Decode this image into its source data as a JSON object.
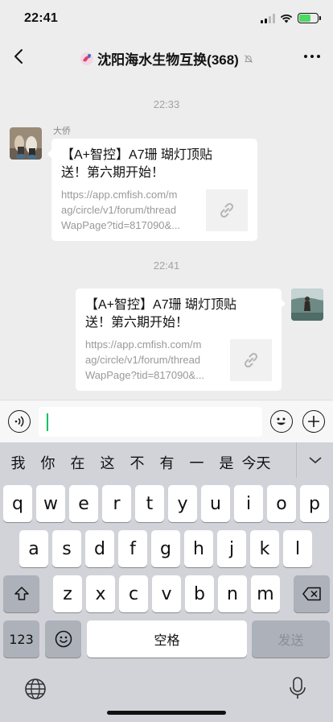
{
  "status_bar": {
    "time": "22:41"
  },
  "nav": {
    "title": "沈阳海水生物互换(368)"
  },
  "messages": [
    {
      "timestamp": "22:33"
    },
    {
      "sender": "大侨",
      "title": "【A+智控】A7珊 瑚灯顶贴\n送！第六期开始！",
      "desc": "https://app.cmfish.com/m\nag/circle/v1/forum/thread\nWapPage?tid=817090&..."
    },
    {
      "timestamp": "22:41"
    },
    {
      "title": "【A+智控】A7珊 瑚灯顶贴\n送！第六期开始！",
      "desc": "https://app.cmfish.com/m\nag/circle/v1/forum/thread\nWapPage?tid=817090&..."
    }
  ],
  "input": {
    "value": ""
  },
  "keyboard": {
    "candidates": [
      "我",
      "你",
      "在",
      "这",
      "不",
      "有",
      "一",
      "是",
      "今天"
    ],
    "row1": [
      "q",
      "w",
      "e",
      "r",
      "t",
      "y",
      "u",
      "i",
      "o",
      "p"
    ],
    "row2": [
      "a",
      "s",
      "d",
      "f",
      "g",
      "h",
      "j",
      "k",
      "l"
    ],
    "row3": [
      "z",
      "x",
      "c",
      "v",
      "b",
      "n",
      "m"
    ],
    "numbers_label": "123",
    "space_label": "空格",
    "send_label": "发送"
  },
  "colors": {
    "background": "#ededed",
    "cursor": "#07c160",
    "keyboard": "#d1d3d9"
  }
}
